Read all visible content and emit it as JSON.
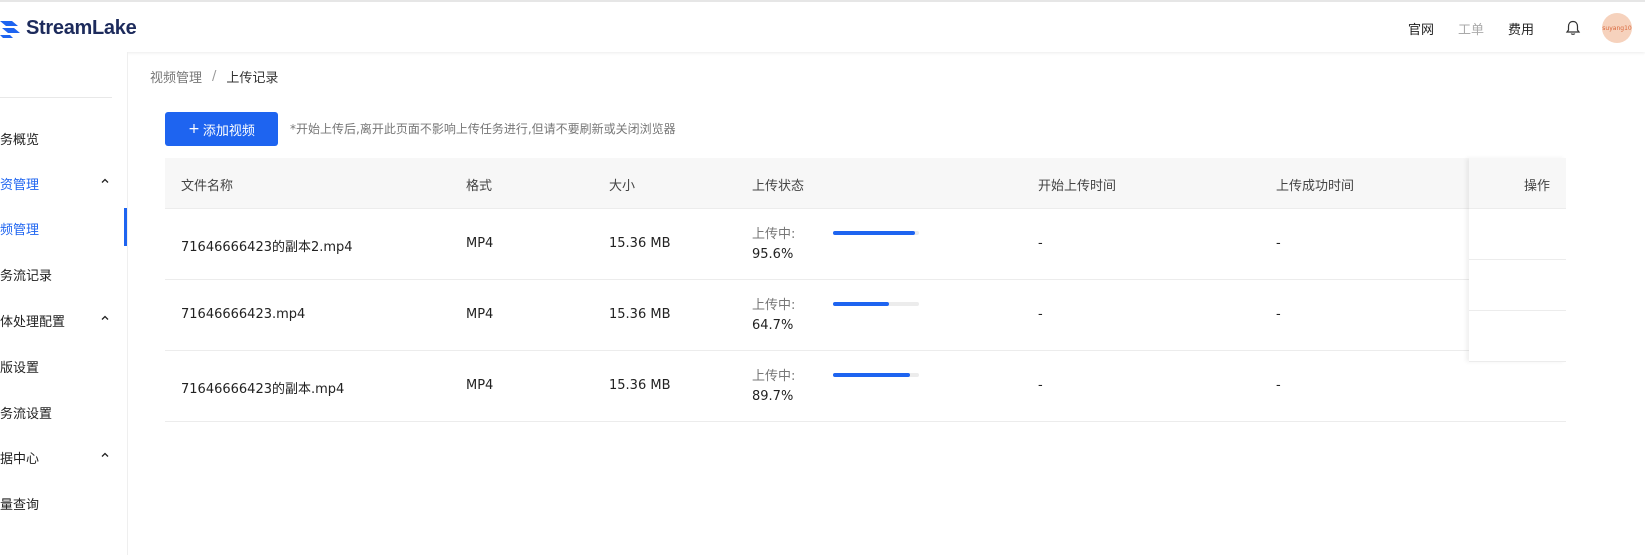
{
  "brand": {
    "name": "StreamLake"
  },
  "topnav": {
    "links": [
      {
        "label": "官网",
        "muted": false
      },
      {
        "label": "工单",
        "muted": true
      },
      {
        "label": "费用",
        "muted": false
      }
    ],
    "avatar_text": "suyang10"
  },
  "sidebar": {
    "items": [
      {
        "label": "务概览",
        "type": "item"
      },
      {
        "label": "资管理",
        "type": "group",
        "expanded": true
      },
      {
        "label": "频管理",
        "type": "item",
        "active": true
      },
      {
        "label": "务流记录",
        "type": "item"
      },
      {
        "label": "体处理配置",
        "type": "group",
        "expanded": true
      },
      {
        "label": "版设置",
        "type": "item"
      },
      {
        "label": "务流设置",
        "type": "item"
      },
      {
        "label": "据中心",
        "type": "group",
        "expanded": true
      },
      {
        "label": "量查询",
        "type": "item"
      }
    ]
  },
  "breadcrumb": {
    "parent": "视频管理",
    "separator": "/",
    "current": "上传记录"
  },
  "toolbar": {
    "add_button": "添加视频",
    "hint": "*开始上传后,离开此页面不影响上传任务进行,但请不要刷新或关闭浏览器"
  },
  "table": {
    "columns": [
      "文件名称",
      "格式",
      "大小",
      "上传状态",
      "开始上传时间",
      "上传成功时间",
      "操作"
    ],
    "rows": [
      {
        "name": "71646666423的副本2.mp4",
        "format": "MP4",
        "size": "15.36 MB",
        "status": "上传中:",
        "percent": "95.6%",
        "progress": 0.956,
        "start": "-",
        "done": "-"
      },
      {
        "name": "71646666423.mp4",
        "format": "MP4",
        "size": "15.36 MB",
        "status": "上传中:",
        "percent": "64.7%",
        "progress": 0.647,
        "start": "-",
        "done": "-"
      },
      {
        "name": "71646666423的副本.mp4",
        "format": "MP4",
        "size": "15.36 MB",
        "status": "上传中:",
        "percent": "89.7%",
        "progress": 0.897,
        "start": "-",
        "done": "-"
      }
    ]
  },
  "colors": {
    "accent": "#1e64f0",
    "logo": "#1d2b5c",
    "avatar_bg": "#f6d2bd"
  },
  "icons": {
    "bell": "bell-icon",
    "chevron": "chevron-up-icon",
    "plus": "plus-icon"
  }
}
